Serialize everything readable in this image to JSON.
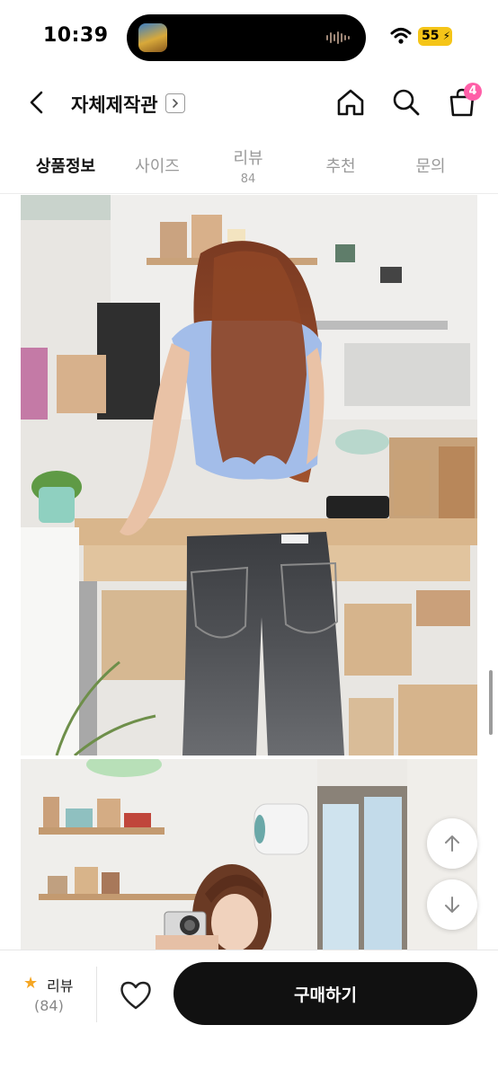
{
  "status_bar": {
    "time": "10:39",
    "battery_level": "55",
    "icons": [
      "app-thumbnail-icon",
      "audio-wave-icon",
      "wifi-icon",
      "battery-icon"
    ]
  },
  "header": {
    "shop_name": "자체제작관",
    "cart_badge": "4",
    "icons": [
      "back-arrow-icon",
      "chevron-right-icon",
      "home-icon",
      "search-icon",
      "shopping-bag-icon"
    ]
  },
  "tabs": [
    {
      "label": "상품정보",
      "active": true
    },
    {
      "label": "사이즈"
    },
    {
      "label": "리뷰",
      "count": "84"
    },
    {
      "label": "추천"
    },
    {
      "label": "문의"
    }
  ],
  "content": {
    "photos": [
      "product-photo-back-view",
      "product-photo-camera"
    ],
    "fab_icons": [
      "arrow-up-icon",
      "arrow-down-icon"
    ]
  },
  "bottom_bar": {
    "review_label": "리뷰",
    "review_count": "(84)",
    "buy_label": "구매하기",
    "icons": [
      "star-icon",
      "heart-icon"
    ]
  },
  "colors": {
    "accent_badge": "#ff5fa8",
    "star": "#f5a623",
    "battery": "#f5c518",
    "buy_button": "#111111"
  }
}
